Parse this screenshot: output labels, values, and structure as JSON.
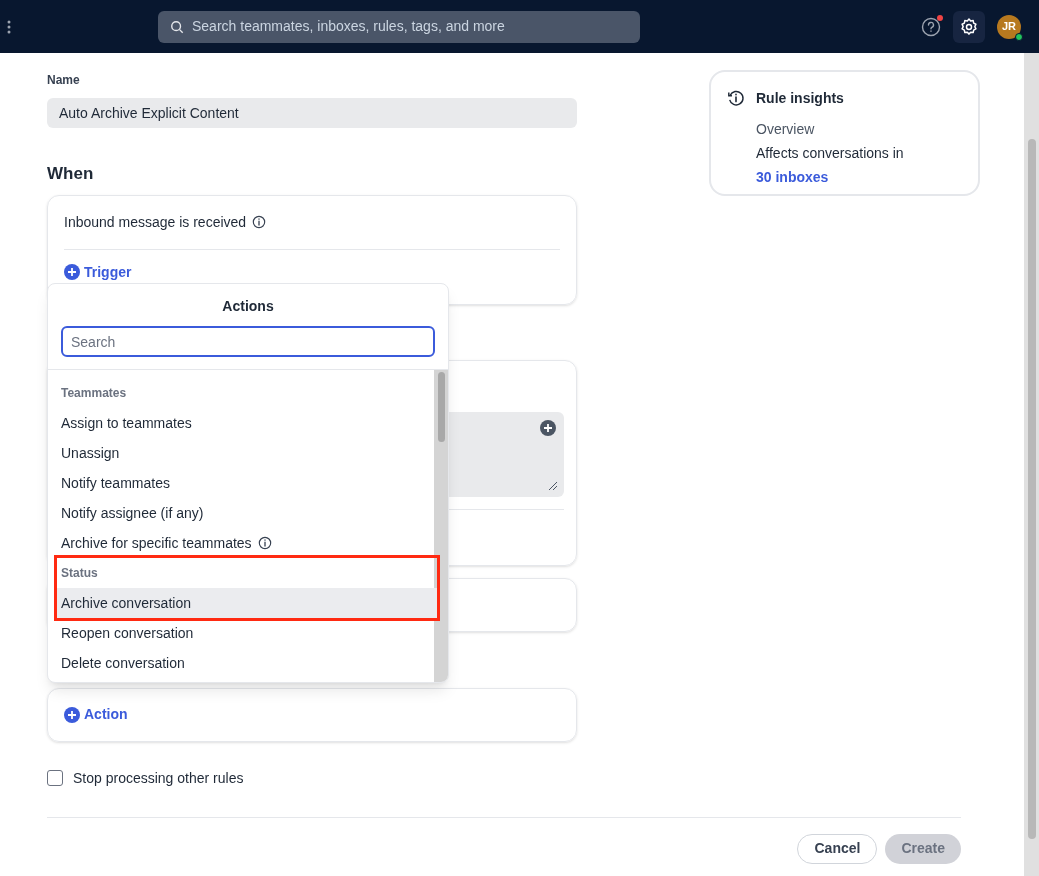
{
  "top_bar": {
    "search": {
      "placeholder": "Search teammates, inboxes, rules, tags, and more"
    },
    "help_notification": true,
    "avatar": {
      "initials": "JR",
      "online": true
    }
  },
  "form": {
    "name_label": "Name",
    "name_value": "Auto Archive Explicit Content",
    "when_heading": "When",
    "trigger_event": "Inbound message is received",
    "add_trigger": "Trigger",
    "add_action": "Action",
    "stop_processing": {
      "label": "Stop processing other rules",
      "checked": false
    }
  },
  "actions_menu": {
    "title": "Actions",
    "search": {
      "placeholder": "Search"
    },
    "groups": [
      {
        "heading": "Teammates",
        "highlighted": false,
        "items": [
          {
            "label": "Assign to teammates",
            "info": false,
            "selected": false
          },
          {
            "label": "Unassign",
            "info": false,
            "selected": false
          },
          {
            "label": "Notify teammates",
            "info": false,
            "selected": false
          },
          {
            "label": "Notify assignee (if any)",
            "info": false,
            "selected": false
          },
          {
            "label": "Archive for specific teammates",
            "info": true,
            "selected": false
          }
        ]
      },
      {
        "heading": "Status",
        "highlighted": true,
        "items": [
          {
            "label": "Archive conversation",
            "info": false,
            "selected": true
          },
          {
            "label": "Reopen conversation",
            "info": false,
            "selected": false
          },
          {
            "label": "Delete conversation",
            "info": false,
            "selected": false
          }
        ]
      }
    ]
  },
  "insights": {
    "title": "Rule insights",
    "subtitle": "Overview",
    "text": "Affects conversations in",
    "link": "30 inboxes"
  },
  "footer": {
    "cancel": "Cancel",
    "create": "Create",
    "create_disabled": true
  }
}
